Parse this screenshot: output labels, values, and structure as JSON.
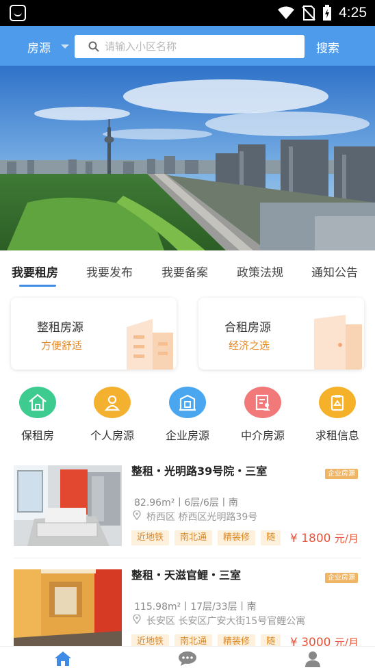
{
  "status_bar": {
    "time": "4:25"
  },
  "header": {
    "city_label": "房源",
    "search_placeholder": "请输入小区名称",
    "search_button": "搜索"
  },
  "tabs": [
    {
      "label": "我要租房",
      "active": true
    },
    {
      "label": "我要发布"
    },
    {
      "label": "我要备案"
    },
    {
      "label": "政策法规"
    },
    {
      "label": "通知公告"
    }
  ],
  "cards": [
    {
      "title": "整租房源",
      "subtitle": "方便舒适"
    },
    {
      "title": "合租房源",
      "subtitle": "经济之选"
    }
  ],
  "categories": [
    {
      "label": "保租房",
      "icon": "house-icon",
      "color": "#3ecb8f"
    },
    {
      "label": "个人房源",
      "icon": "person-icon",
      "color": "#f4b12f"
    },
    {
      "label": "企业房源",
      "icon": "building-icon",
      "color": "#4aa6ef"
    },
    {
      "label": "中介房源",
      "icon": "agent-doc-icon",
      "color": "#f1797a"
    },
    {
      "label": "求租信息",
      "icon": "clipboard-icon",
      "color": "#f6b12a"
    }
  ],
  "listings": [
    {
      "title": "整租・光明路39号院・三室",
      "badge": "企业房源",
      "meta": "82.96m²丨6层/6层丨南",
      "address": "桥西区 桥西区光明路39号",
      "tags": [
        "近地铁",
        "南北通",
        "精装修",
        "随"
      ],
      "price": "¥ 1800",
      "price_unit": "元/月"
    },
    {
      "title": "整租・天滋官鲤・三室",
      "badge": "企业房源",
      "meta": "115.98m²丨17层/33层丨南",
      "address": "长安区 长安区广安大街15号官鲤公寓",
      "tags": [
        "近地铁",
        "南北通",
        "精装修",
        "随"
      ],
      "price": "¥ 3000",
      "price_unit": "元/月"
    }
  ],
  "bottom_nav": [
    {
      "icon": "home-icon",
      "color": "#3f8be6"
    },
    {
      "icon": "chat-icon",
      "color": "#888888"
    },
    {
      "icon": "user-icon",
      "color": "#888888"
    }
  ]
}
